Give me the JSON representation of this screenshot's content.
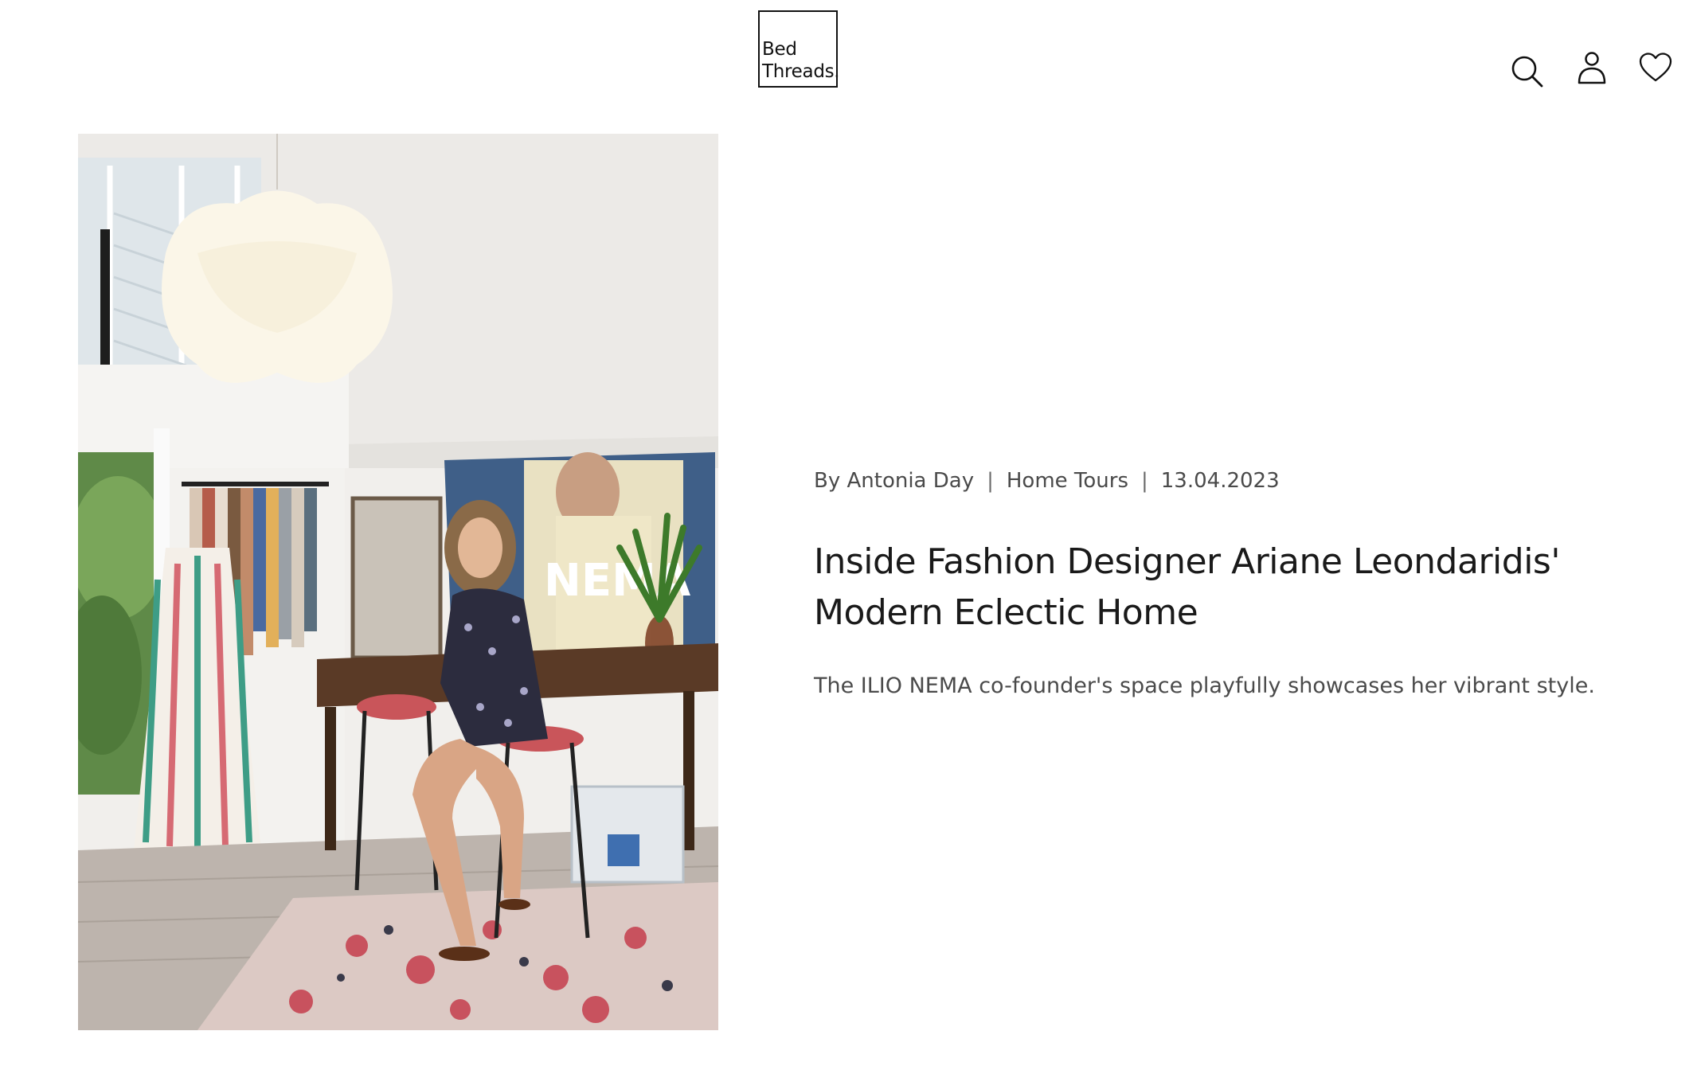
{
  "header": {
    "logo_line1": "Bed",
    "logo_line2": "Threads.",
    "icons": [
      "search-icon",
      "account-icon",
      "wishlist-heart-icon"
    ]
  },
  "hero_image": {
    "alt": "Ariane Leondaridis seated on a stool in her studio"
  },
  "article": {
    "author": "By Antonia Day",
    "category": "Home Tours",
    "date": "13.04.2023",
    "separator": "|",
    "title": "Inside Fashion Designer Ariane Leondaridis' Modern Eclectic Home",
    "subtitle": "The ILIO NEMA co-founder's space playfully showcases her vibrant style."
  },
  "colors": {
    "text": "#1a1a1a",
    "meta_text": "#4a4a4a",
    "background": "#ffffff"
  }
}
